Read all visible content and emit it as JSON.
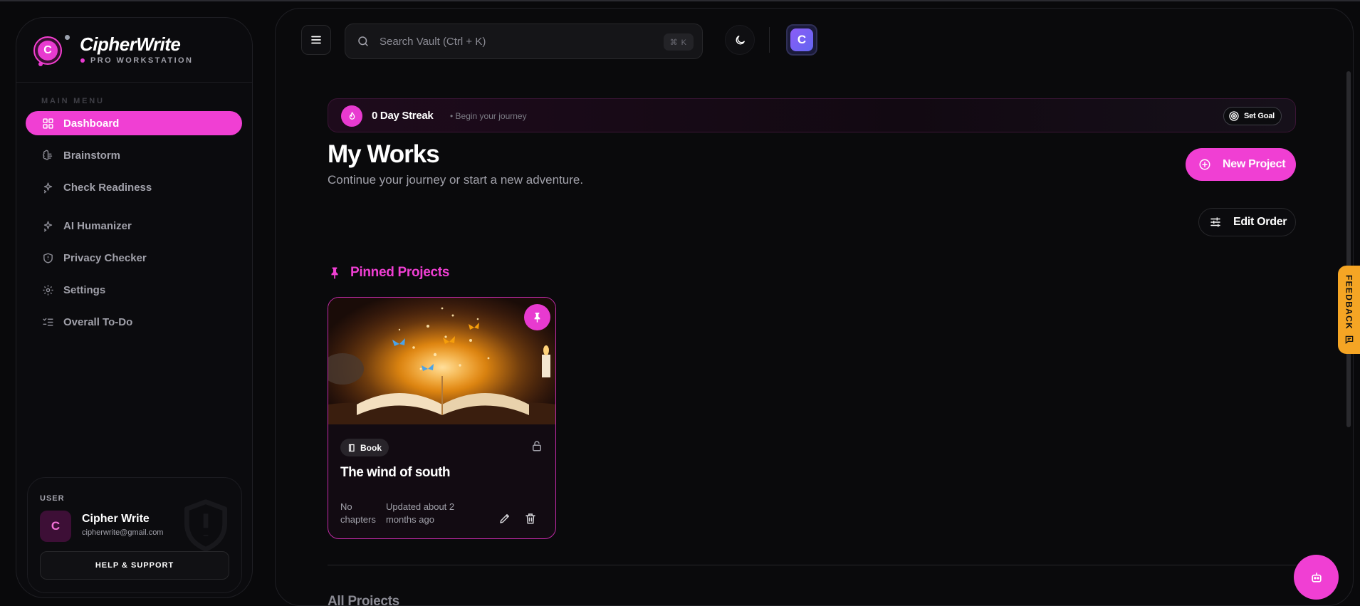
{
  "brand": {
    "logo_letter": "C",
    "name": "CipherWrite",
    "subtitle": "PRO WORKSTATION"
  },
  "sidebar": {
    "menu_label": "MAIN MENU",
    "items": [
      {
        "label": "Dashboard",
        "icon": "grid-icon",
        "active": true
      },
      {
        "label": "Brainstorm",
        "icon": "brain-icon",
        "active": false
      },
      {
        "label": "Check Readiness",
        "icon": "sparkle-icon",
        "active": false
      },
      {
        "label": "AI Humanizer",
        "icon": "sparkle-icon",
        "active": false
      },
      {
        "label": "Privacy Checker",
        "icon": "shield-icon",
        "active": false
      },
      {
        "label": "Settings",
        "icon": "gear-icon",
        "active": false
      },
      {
        "label": "Overall To-Do",
        "icon": "checklist-icon",
        "active": false
      }
    ],
    "user": {
      "label": "USER",
      "avatar_letter": "C",
      "name": "Cipher Write",
      "email": "cipherwrite@gmail.com"
    },
    "help_label": "HELP & SUPPORT"
  },
  "topbar": {
    "search_placeholder": "Search Vault (Ctrl + K)",
    "shortcut": "⌘ K",
    "avatar_letter": "C"
  },
  "streak": {
    "title": "0 Day Streak",
    "subtitle": "• Begin your journey",
    "set_goal_label": "Set Goal"
  },
  "main": {
    "title": "My Works",
    "subtitle": "Continue your journey or start a new adventure.",
    "new_project_label": "New Project",
    "edit_order_label": "Edit Order",
    "pinned_title": "Pinned Projects",
    "all_projects_title": "All Projects"
  },
  "pinned_projects": [
    {
      "type": "Book",
      "title": "The wind of south",
      "chapters": "No chapters",
      "updated": "Updated about 2 months ago"
    }
  ],
  "feedback_label": "FEEDBACK",
  "colors": {
    "accent": "#f03fd3",
    "background": "#09090b",
    "feedback": "#f5a524"
  }
}
